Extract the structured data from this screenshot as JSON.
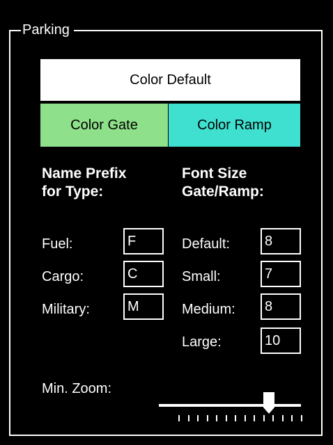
{
  "group": {
    "title": "Parking"
  },
  "buttons": {
    "color_default": {
      "label": "Color Default",
      "color": "#ffffff"
    },
    "color_gate": {
      "label": "Color Gate",
      "color": "#8fe08a"
    },
    "color_ramp": {
      "label": "Color Ramp",
      "color": "#40e0d0"
    }
  },
  "prefix": {
    "heading_line1": "Name Prefix",
    "heading_line2": "for Type:",
    "rows": [
      {
        "label": "Fuel:",
        "value": "F"
      },
      {
        "label": "Cargo:",
        "value": "C"
      },
      {
        "label": "Military:",
        "value": "M"
      }
    ]
  },
  "font_size": {
    "heading_line1": "Font Size",
    "heading_line2": "Gate/Ramp:",
    "rows": [
      {
        "label": "Default:",
        "value": "8"
      },
      {
        "label": "Small:",
        "value": "7"
      },
      {
        "label": "Medium:",
        "value": "8"
      },
      {
        "label": "Large:",
        "value": "10"
      }
    ]
  },
  "min_zoom": {
    "label": "Min. Zoom:",
    "position_fraction": 0.8,
    "tick_count": 14
  }
}
